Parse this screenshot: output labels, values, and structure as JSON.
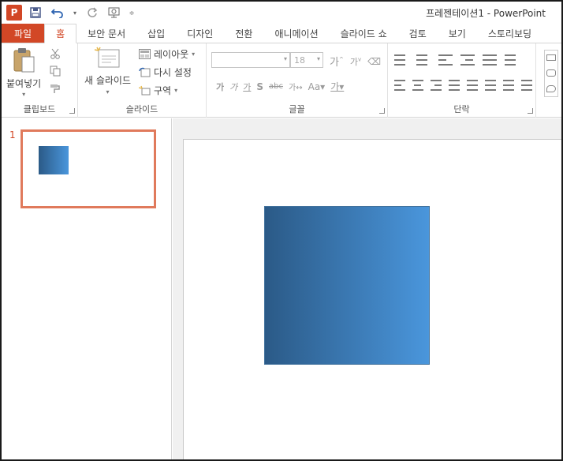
{
  "window": {
    "title": "프레젠테이션1 - PowerPoint",
    "app_icon_letter": "P"
  },
  "tabs": [
    {
      "label": "파일"
    },
    {
      "label": "홈"
    },
    {
      "label": "보안 문서"
    },
    {
      "label": "삽입"
    },
    {
      "label": "디자인"
    },
    {
      "label": "전환"
    },
    {
      "label": "애니메이션"
    },
    {
      "label": "슬라이드 쇼"
    },
    {
      "label": "검토"
    },
    {
      "label": "보기"
    },
    {
      "label": "스토리보딩"
    }
  ],
  "ribbon": {
    "clipboard": {
      "group_label": "클립보드",
      "paste_label": "붙여넣기"
    },
    "slides": {
      "group_label": "슬라이드",
      "new_slide_label": "새 슬라이드",
      "layout_label": "레이아웃",
      "reset_label": "다시 설정",
      "section_label": "구역"
    },
    "font": {
      "group_label": "글꼴",
      "font_name": "",
      "font_size": "18"
    },
    "paragraph": {
      "group_label": "단락"
    }
  },
  "slides_pane": {
    "slide_number": "1"
  },
  "colors": {
    "accent": "#d24726",
    "thumb_border": "#e07a5c",
    "shape_gradient_start": "#2b5a87",
    "shape_gradient_end": "#4a96dc"
  }
}
